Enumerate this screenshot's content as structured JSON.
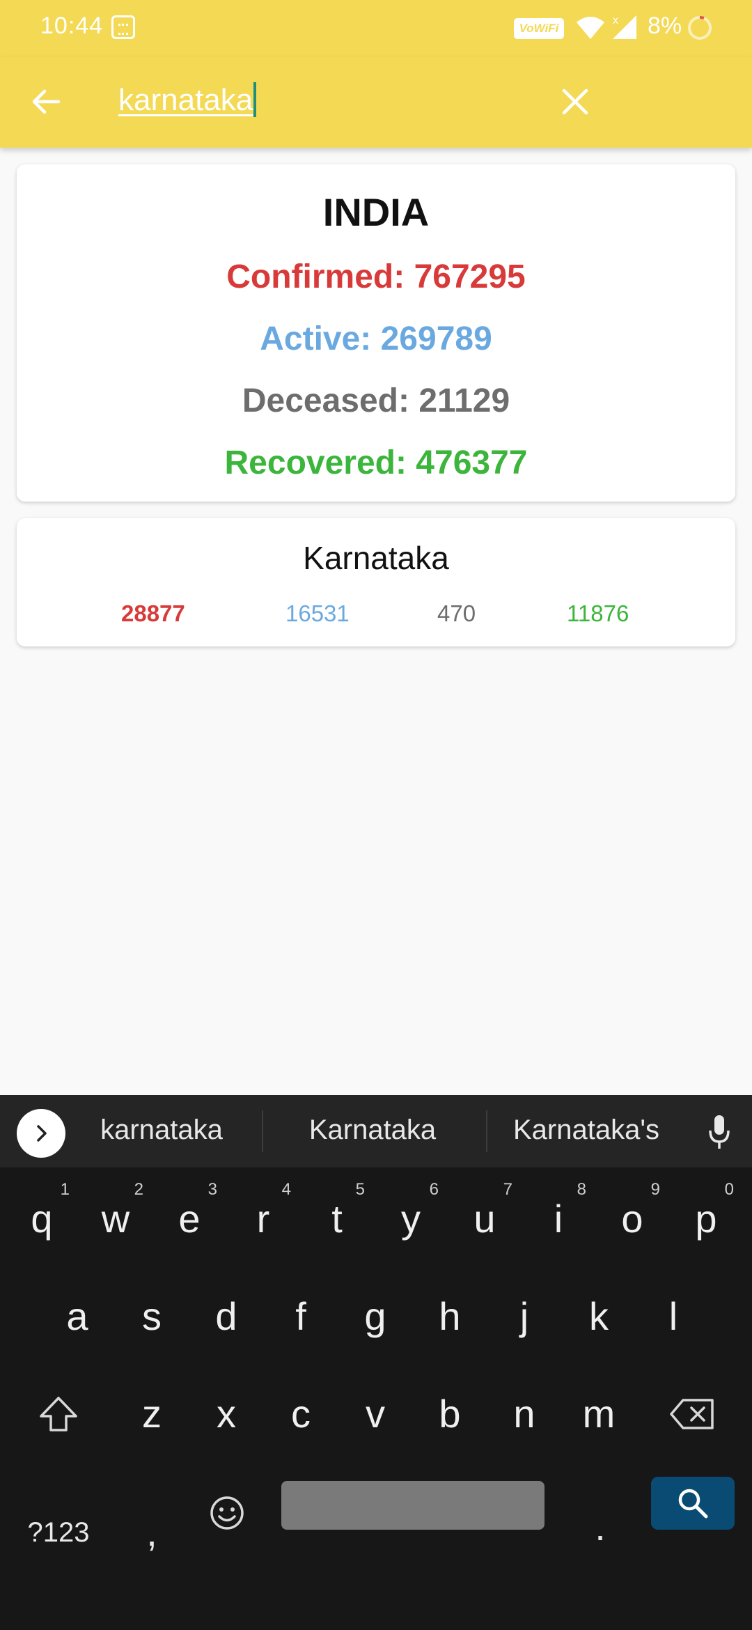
{
  "status_bar": {
    "time": "10:44",
    "vowifi_label": "VoWiFi",
    "battery_percent": "8%"
  },
  "search": {
    "query": "karnataka"
  },
  "india_card": {
    "title": "INDIA",
    "confirmed": "Confirmed: 767295",
    "active": "Active: 269789",
    "deceased": "Deceased: 21129",
    "recovered": "Recovered: 476377"
  },
  "state_card": {
    "name": "Karnataka",
    "confirmed": "28877",
    "active": "16531",
    "deceased": "470",
    "recovered": "11876"
  },
  "colors": {
    "app_bar": "#f4d955",
    "confirmed": "#d83a3a",
    "active": "#6aa9e0",
    "deceased": "#6d6d6d",
    "recovered": "#3bb53b",
    "keyboard_bg": "#171717",
    "search_key": "#0a4b73"
  },
  "keyboard": {
    "suggestions": [
      "karnataka",
      "Karnataka",
      "Karnataka's"
    ],
    "row1": [
      {
        "key": "q",
        "hint": "1"
      },
      {
        "key": "w",
        "hint": "2"
      },
      {
        "key": "e",
        "hint": "3"
      },
      {
        "key": "r",
        "hint": "4"
      },
      {
        "key": "t",
        "hint": "5"
      },
      {
        "key": "y",
        "hint": "6"
      },
      {
        "key": "u",
        "hint": "7"
      },
      {
        "key": "i",
        "hint": "8"
      },
      {
        "key": "o",
        "hint": "9"
      },
      {
        "key": "p",
        "hint": "0"
      }
    ],
    "row2": [
      "a",
      "s",
      "d",
      "f",
      "g",
      "h",
      "j",
      "k",
      "l"
    ],
    "row3": [
      "z",
      "x",
      "c",
      "v",
      "b",
      "n",
      "m"
    ],
    "symbols_label": "?123",
    "comma": ",",
    "period": "."
  },
  "icons": {
    "back": "arrow-left-icon",
    "clear": "close-icon",
    "expand": "chevron-right-icon",
    "mic": "microphone-icon",
    "shift": "shift-icon",
    "backspace": "backspace-icon",
    "emoji": "emoji-icon",
    "search": "search-icon"
  }
}
